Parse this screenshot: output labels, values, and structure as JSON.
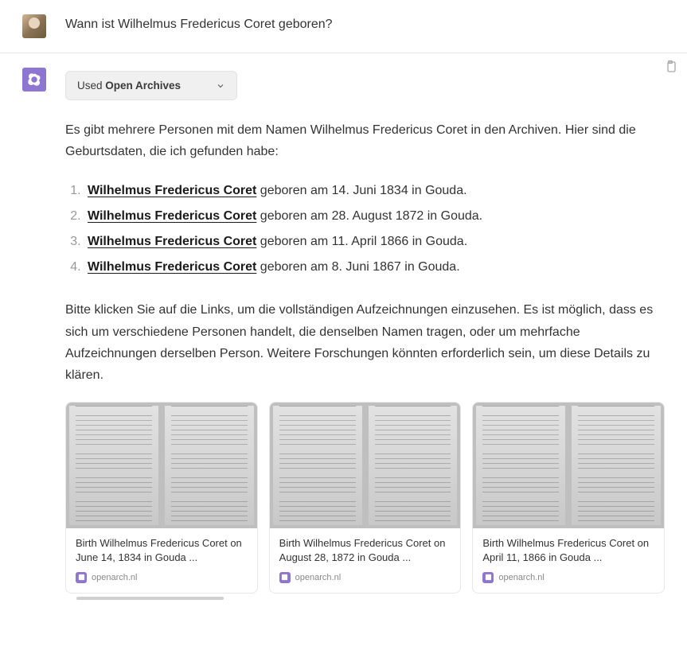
{
  "user": {
    "question": "Wann ist Wilhelmus Fredericus Coret geboren?"
  },
  "tool": {
    "used_prefix": "Used ",
    "name": "Open Archives"
  },
  "response": {
    "intro": "Es gibt mehrere Personen mit dem Namen Wilhelmus Fredericus Coret in den Archiven. Hier sind die Geburtsdaten, die ich gefunden habe:",
    "items": [
      {
        "link": "Wilhelmus Fredericus Coret",
        "rest": " geboren am 14. Juni 1834 in Gouda."
      },
      {
        "link": "Wilhelmus Fredericus Coret",
        "rest": " geboren am 28. August 1872 in Gouda."
      },
      {
        "link": "Wilhelmus Fredericus Coret",
        "rest": " geboren am 11. April 1866 in Gouda."
      },
      {
        "link": "Wilhelmus Fredericus Coret",
        "rest": " geboren am 8. Juni 1867 in Gouda."
      }
    ],
    "outro": "Bitte klicken Sie auf die Links, um die vollständigen Aufzeichnungen einzusehen. Es ist möglich, dass es sich um verschiedene Personen handelt, die denselben Namen tragen, oder um mehrfache Aufzeichnungen derselben Person. Weitere Forschungen könnten erforderlich sein, um diese Details zu klären."
  },
  "cards": [
    {
      "title": "Birth Wilhelmus Fredericus Coret on June 14, 1834 in Gouda ...",
      "source": "openarch.nl"
    },
    {
      "title": "Birth Wilhelmus Fredericus Coret on August 28, 1872 in Gouda ...",
      "source": "openarch.nl"
    },
    {
      "title": "Birth Wilhelmus Fredericus Coret on April 11, 1866 in Gouda ...",
      "source": "openarch.nl"
    }
  ]
}
